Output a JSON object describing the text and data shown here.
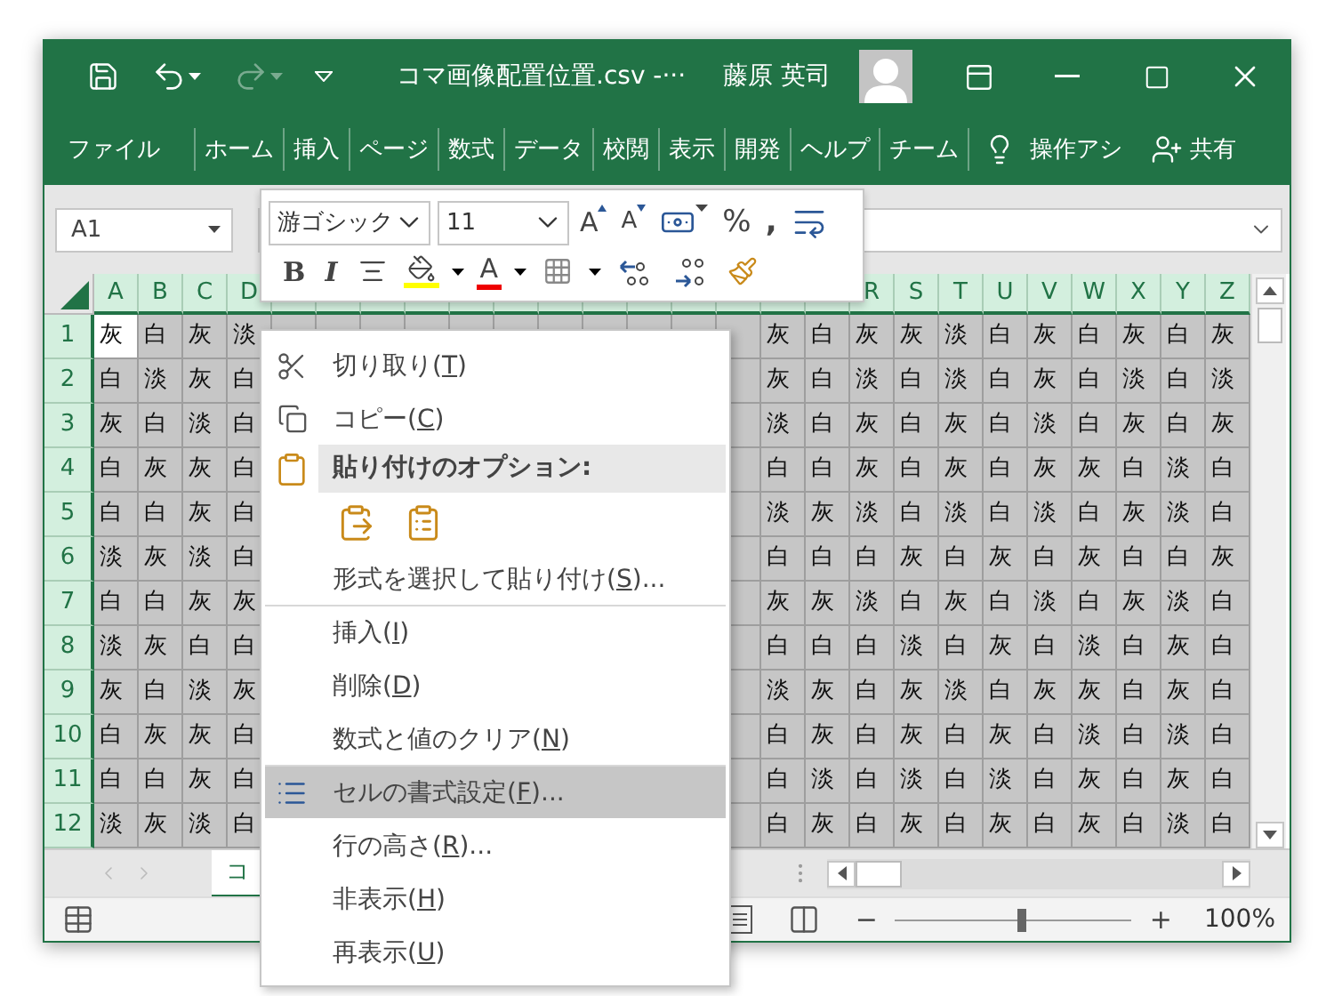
{
  "title_bar": {
    "quick_access": [
      {
        "kind": "save",
        "disabled": false
      },
      {
        "kind": "undo",
        "disabled": false
      },
      {
        "kind": "redo",
        "disabled": true
      },
      {
        "kind": "customize",
        "disabled": false
      }
    ],
    "title": "コマ画像配置位置.csv  -···",
    "user": "藤原 英司"
  },
  "ribbon_tabs": [
    {
      "label": "ファイル",
      "selected": false
    },
    {
      "label": "ホーム",
      "selected": false
    },
    {
      "label": "挿入",
      "selected": false
    },
    {
      "label": "ページ",
      "selected": false
    },
    {
      "label": "数式",
      "selected": false
    },
    {
      "label": "データ",
      "selected": false
    },
    {
      "label": "校閲",
      "selected": false
    },
    {
      "label": "表示",
      "selected": false
    },
    {
      "label": "開発",
      "selected": false
    },
    {
      "label": "ヘルプ",
      "selected": false
    },
    {
      "label": "チーム",
      "selected": false
    }
  ],
  "tell_me": "操作アシ",
  "share": "共有",
  "name_box": "A1",
  "mini_toolbar": {
    "font": "游ゴシック",
    "size": "11",
    "grow": "A",
    "shrink": "A",
    "percent": "%",
    "comma": ",",
    "bold": "B",
    "italic": "I",
    "font_color": "A"
  },
  "columns": {
    "left": [
      "A",
      "B",
      "C",
      "D"
    ],
    "right": [
      "R",
      "S",
      "T",
      "U",
      "V",
      "W",
      "X",
      "Y",
      "Z"
    ]
  },
  "rows": [
    {
      "header": "1",
      "first_cell_active": true,
      "left": [
        "灰",
        "白",
        "灰",
        "淡"
      ],
      "right": [
        "灰",
        "白",
        "灰",
        "灰",
        "淡",
        "白",
        "灰",
        "白",
        "灰",
        "白",
        "灰"
      ]
    },
    {
      "header": "2",
      "first_cell_active": false,
      "left": [
        "白",
        "淡",
        "灰",
        "白"
      ],
      "right": [
        "灰",
        "白",
        "淡",
        "白",
        "淡",
        "白",
        "灰",
        "白",
        "淡",
        "白",
        "淡"
      ]
    },
    {
      "header": "3",
      "first_cell_active": false,
      "left": [
        "灰",
        "白",
        "淡",
        "白"
      ],
      "right": [
        "淡",
        "白",
        "灰",
        "白",
        "灰",
        "白",
        "淡",
        "白",
        "灰",
        "白",
        "灰"
      ]
    },
    {
      "header": "4",
      "first_cell_active": false,
      "left": [
        "白",
        "灰",
        "灰",
        "白"
      ],
      "right": [
        "白",
        "白",
        "灰",
        "白",
        "灰",
        "白",
        "灰",
        "灰",
        "白",
        "淡",
        "白"
      ]
    },
    {
      "header": "5",
      "first_cell_active": false,
      "left": [
        "白",
        "白",
        "灰",
        "白"
      ],
      "right": [
        "淡",
        "灰",
        "淡",
        "白",
        "淡",
        "白",
        "淡",
        "白",
        "灰",
        "淡",
        "白"
      ]
    },
    {
      "header": "6",
      "first_cell_active": false,
      "left": [
        "淡",
        "灰",
        "淡",
        "白"
      ],
      "right": [
        "白",
        "白",
        "白",
        "灰",
        "白",
        "灰",
        "白",
        "灰",
        "白",
        "白",
        "灰"
      ]
    },
    {
      "header": "7",
      "first_cell_active": false,
      "left": [
        "白",
        "白",
        "灰",
        "灰"
      ],
      "right": [
        "灰",
        "灰",
        "淡",
        "白",
        "灰",
        "白",
        "淡",
        "白",
        "灰",
        "淡",
        "白"
      ]
    },
    {
      "header": "8",
      "first_cell_active": false,
      "left": [
        "淡",
        "灰",
        "白",
        "白"
      ],
      "right": [
        "白",
        "白",
        "白",
        "淡",
        "白",
        "灰",
        "白",
        "淡",
        "白",
        "灰",
        "白"
      ]
    },
    {
      "header": "9",
      "first_cell_active": false,
      "left": [
        "灰",
        "白",
        "淡",
        "灰"
      ],
      "right": [
        "淡",
        "灰",
        "白",
        "灰",
        "淡",
        "白",
        "灰",
        "灰",
        "白",
        "灰",
        "白"
      ]
    },
    {
      "header": "10",
      "first_cell_active": false,
      "left": [
        "白",
        "灰",
        "灰",
        "白"
      ],
      "right": [
        "白",
        "灰",
        "白",
        "灰",
        "白",
        "灰",
        "白",
        "淡",
        "白",
        "淡",
        "白"
      ]
    },
    {
      "header": "11",
      "first_cell_active": false,
      "left": [
        "白",
        "白",
        "灰",
        "白"
      ],
      "right": [
        "白",
        "淡",
        "白",
        "淡",
        "白",
        "淡",
        "白",
        "灰",
        "白",
        "灰",
        "白"
      ]
    },
    {
      "header": "12",
      "first_cell_active": false,
      "left": [
        "淡",
        "灰",
        "淡",
        "白"
      ],
      "right": [
        "白",
        "灰",
        "白",
        "灰",
        "白",
        "灰",
        "白",
        "灰",
        "白",
        "淡",
        "白"
      ]
    }
  ],
  "context_menu": [
    {
      "kind": "cut",
      "before": "切り取り(",
      "key": "T",
      "after": ")",
      "selected": false,
      "divider_above": false
    },
    {
      "kind": "copy",
      "before": "コピー(",
      "key": "C",
      "after": ")",
      "selected": false,
      "divider_above": false
    },
    {
      "kind": "header",
      "before": "貼り付けのオプション:",
      "selected": false,
      "divider_above": false
    },
    {
      "kind": "paste_icons",
      "selected": false,
      "divider_above": false
    },
    {
      "kind": "command",
      "before": "形式を選択して貼り付け(",
      "key": "S",
      "after": ")...",
      "selected": false,
      "divider_above": false
    },
    {
      "kind": "command",
      "before": "挿入(",
      "key": "I",
      "after": ")",
      "selected": false,
      "divider_above": true
    },
    {
      "kind": "command",
      "before": "削除(",
      "key": "D",
      "after": ")",
      "selected": false,
      "divider_above": false
    },
    {
      "kind": "command",
      "before": "数式と値のクリア(",
      "key": "N",
      "after": ")",
      "selected": false,
      "divider_above": false
    },
    {
      "kind": "format",
      "before": "セルの書式設定(",
      "key": "F",
      "after": ")...",
      "selected": true,
      "divider_above": true
    },
    {
      "kind": "command",
      "before": "行の高さ(",
      "key": "R",
      "after": ")...",
      "selected": false,
      "divider_above": false
    },
    {
      "kind": "command",
      "before": "非表示(",
      "key": "H",
      "after": ")",
      "selected": false,
      "divider_above": false
    },
    {
      "kind": "command",
      "before": "再表示(",
      "key": "U",
      "after": ")",
      "selected": false,
      "divider_above": false
    }
  ],
  "sheet_tab": {
    "label": "コ",
    "selected": true
  },
  "status_bar": {
    "minus": "−",
    "plus": "+",
    "zoom": "100%",
    "level": 0.53
  }
}
